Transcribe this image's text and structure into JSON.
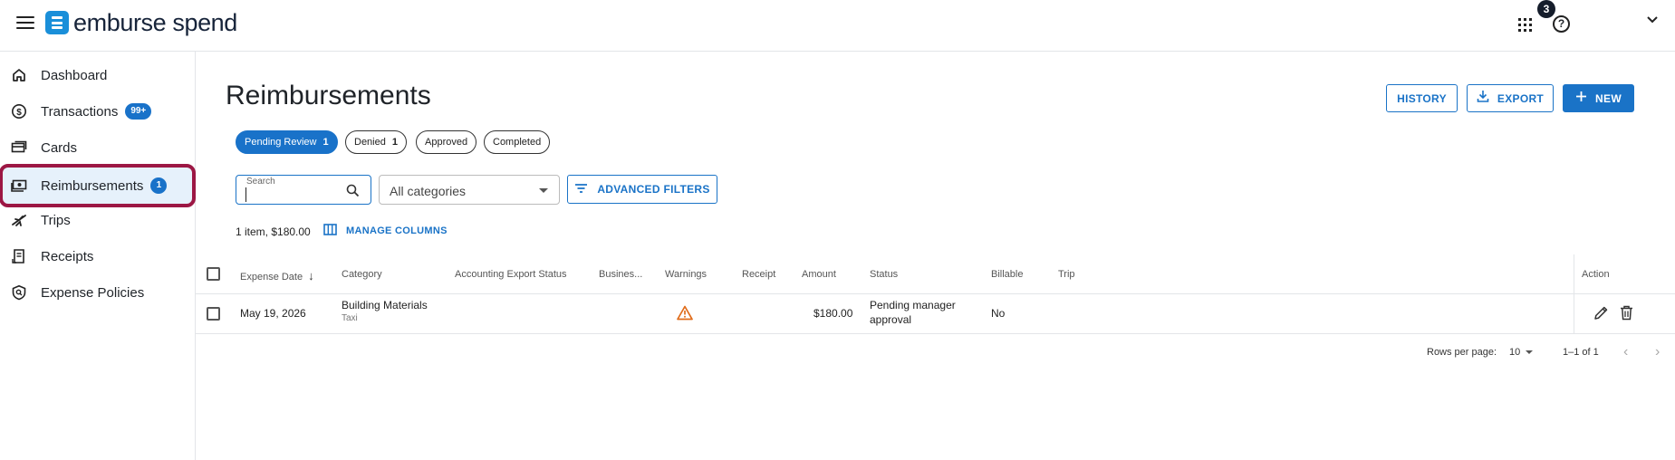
{
  "header": {
    "logo_text": "emburse spend",
    "notification_count": "3",
    "help_glyph": "?",
    "icons": [
      "menu-icon",
      "apps-grid-icon",
      "help-icon",
      "chevron-down-icon"
    ]
  },
  "sidebar": {
    "items": [
      {
        "label": "Dashboard",
        "icon": "home-icon",
        "badge": ""
      },
      {
        "label": "Transactions",
        "icon": "dollar-circle-icon",
        "badge": "99+"
      },
      {
        "label": "Cards",
        "icon": "cards-icon",
        "badge": ""
      },
      {
        "label": "Reimbursements",
        "icon": "money-icon",
        "badge": "1",
        "active": true
      },
      {
        "label": "Trips",
        "icon": "plane-icon",
        "badge": ""
      },
      {
        "label": "Receipts",
        "icon": "receipt-icon",
        "badge": ""
      },
      {
        "label": "Expense Policies",
        "icon": "policy-icon",
        "badge": ""
      }
    ]
  },
  "main": {
    "title": "Reimbursements",
    "buttons": {
      "history": "HISTORY",
      "export": "EXPORT",
      "new": "NEW"
    },
    "chips": [
      {
        "label": "Pending Review",
        "count": "1",
        "active": true
      },
      {
        "label": "Denied",
        "count": "1",
        "active": false
      },
      {
        "label": "Approved",
        "count": "",
        "active": false
      },
      {
        "label": "Completed",
        "count": "",
        "active": false
      }
    ],
    "search": {
      "label": "Search",
      "value": ""
    },
    "category_select": {
      "value": "All categories"
    },
    "advanced_filters": "ADVANCED FILTERS",
    "summary": "1 item, $180.00",
    "manage_columns": "MANAGE COLUMNS"
  },
  "table": {
    "columns": [
      "Expense Date",
      "Category",
      "Accounting Export Status",
      "Busines...",
      "Warnings",
      "Receipt",
      "Amount",
      "Status",
      "Billable",
      "Trip",
      "Action"
    ],
    "sorted_column": "Expense Date",
    "sort_direction": "descending",
    "rows": [
      {
        "expense_date": "May 19, 2026",
        "category": "Building Materials",
        "subcategory": "Taxi",
        "accounting_export_status": "",
        "business": "",
        "warning_icon": "warning-triangle-icon",
        "receipt": "",
        "amount": "$180.00",
        "status_line1": "Pending manager",
        "status_line2": "approval",
        "billable": "No",
        "trip": ""
      }
    ]
  },
  "pagination": {
    "rows_per_page_label": "Rows per page:",
    "rows_per_page": "10",
    "range": "1–1 of 1"
  },
  "colors": {
    "accent": "#1a73c7",
    "highlight": "#9c1744",
    "warning": "#e06c1b"
  }
}
